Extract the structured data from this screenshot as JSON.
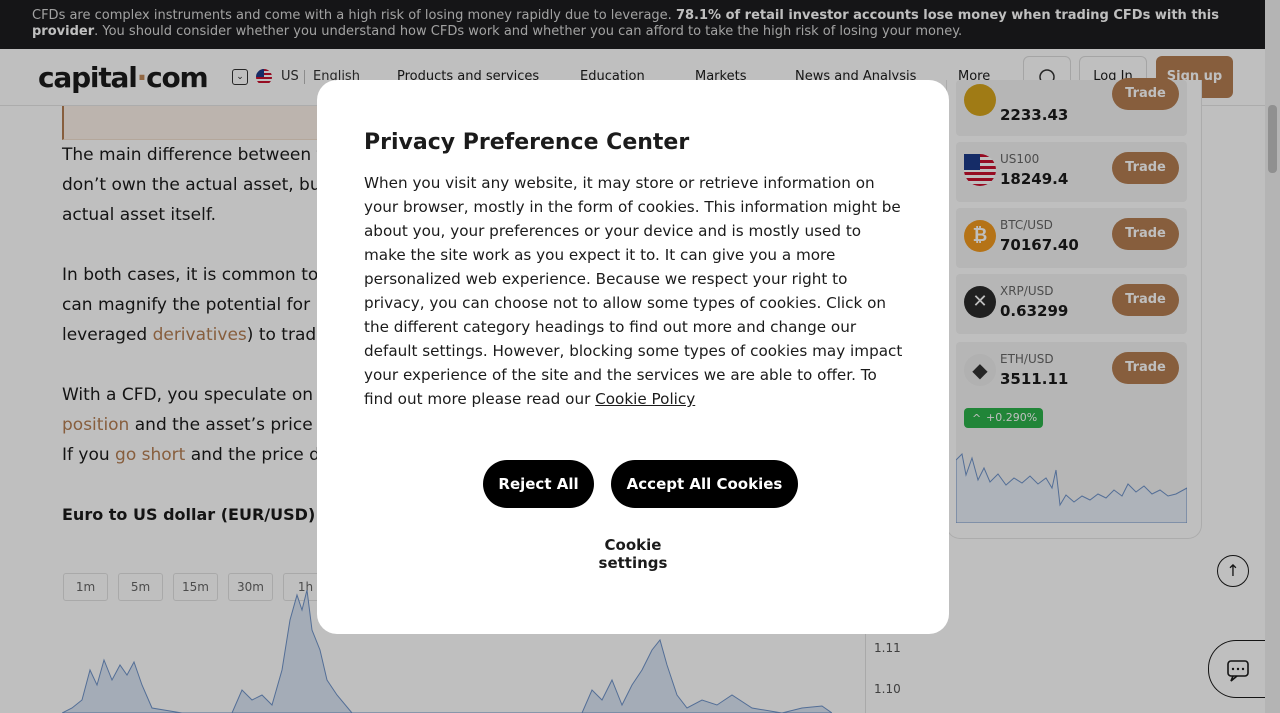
{
  "risk_banner": {
    "text_before": "CFDs are complex instruments and come with a high risk of losing money rapidly due to leverage. ",
    "text_bold": "78.1% of retail investor accounts lose money when trading CFDs with this provider",
    "text_after": ". You should consider whether you understand how CFDs work and whether you can afford to take the high risk of losing your money."
  },
  "header": {
    "logo_a": "capital",
    "logo_dot": "·",
    "logo_b": "com",
    "region": "US",
    "language": "English",
    "nav": [
      "Products and services",
      "Education",
      "Markets",
      "News and Analysis",
      "More"
    ],
    "login_label": "Log In",
    "signup_label": "Sign up"
  },
  "article": {
    "p1_l1": "The main difference between fo",
    "p1_l2": "don’t own the actual asset, but",
    "p1_l3": "actual asset itself.",
    "p2_l1": "In both cases, it is common to t",
    "p2_l2": "can magnify the potential for p",
    "p2_l3a": "leveraged ",
    "p2_l3_link": "derivatives",
    "p2_l3b": ") to trade",
    "p3_l1": "With a CFD, you speculate on t",
    "p3_l2_link": "position",
    "p3_l2b": " and the asset’s price ri",
    "p3_l3a": "If you ",
    "p3_l3_link": "go short",
    "p3_l3b": " and the price dr",
    "chart_title": "Euro to US dollar (EUR/USD) for",
    "timeframes": [
      "1m",
      "5m",
      "15m",
      "30m",
      "1h"
    ],
    "y_labels": [
      "1.11",
      "1.10"
    ]
  },
  "markets": [
    {
      "symbol": "",
      "price": "2233.43",
      "trade": "Trade",
      "icon": "gold-coin-icon"
    },
    {
      "symbol": "US100",
      "price": "18249.4",
      "trade": "Trade",
      "icon": "us-flag-icon"
    },
    {
      "symbol": "BTC/USD",
      "price": "70167.40",
      "trade": "Trade",
      "icon": "bitcoin-icon"
    },
    {
      "symbol": "XRP/USD",
      "price": "0.63299",
      "trade": "Trade",
      "icon": "xrp-icon"
    },
    {
      "symbol": "ETH/USD",
      "price": "3511.11",
      "trade": "Trade",
      "icon": "ethereum-icon",
      "change": "+0.290%"
    }
  ],
  "modal": {
    "title": "Privacy Preference Center",
    "body": "When you visit any website, it may store or retrieve information on your browser, mostly in the form of cookies. This information might be about you, your preferences or your device and is mostly used to make the site work as you expect it to. It can give you a more personalized web experience. Because we respect your right to privacy, you can choose not to allow some types of cookies. Click on the different category headings to find out more and change our default settings. However, blocking some types of cookies may impact your experience of the site and the services we are able to offer. To find out more please read our ",
    "policy_link": "Cookie Policy",
    "reject_label": "Reject All",
    "accept_label": "Accept All Cookies",
    "settings_label": "Cookie settings"
  },
  "colors": {
    "accent": "#b57e52",
    "positive": "#2db24b",
    "banner_bg": "#1d1d1f"
  }
}
